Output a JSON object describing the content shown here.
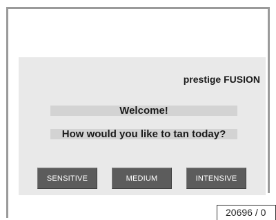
{
  "screen": {
    "brand": "prestige FUSION",
    "welcome": "Welcome!",
    "question": "How would you like to tan today?",
    "buttons": {
      "sensitive": "SENSITIVE",
      "medium": "MEDIUM",
      "intensive": "INTENSIVE"
    }
  },
  "figure_id": "20696 / 0"
}
